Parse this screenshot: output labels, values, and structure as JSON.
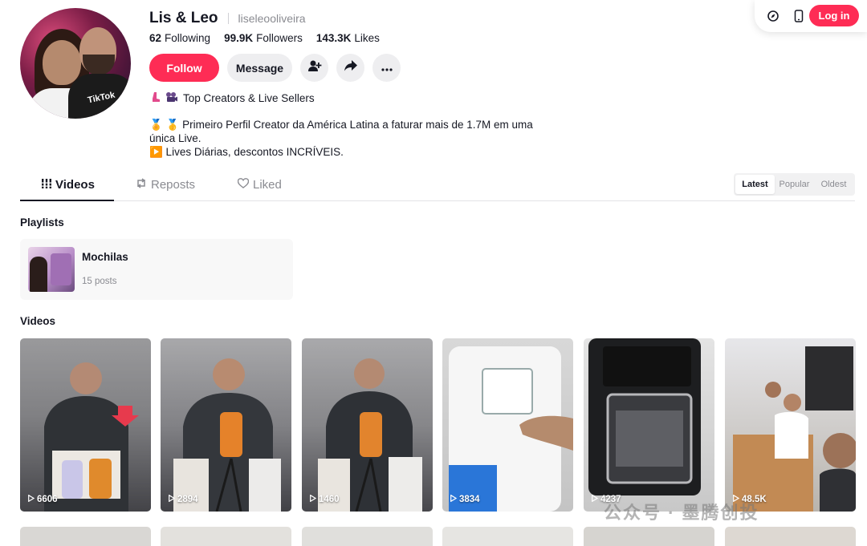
{
  "toolbar": {
    "icons": [
      "compass-icon",
      "phone-icon"
    ],
    "login_label": "Log in",
    "accent_color": "#fe2c55"
  },
  "profile": {
    "name": "Lis & Leo",
    "handle": "liseleooliveira",
    "following_count": "62",
    "following_label": "Following",
    "followers_count": "99.9K",
    "followers_label": "Followers",
    "likes_count": "143.3K",
    "likes_label": "Likes",
    "follow_label": "Follow",
    "message_label": "Message",
    "badge_text": "Top Creators & Live Sellers",
    "bio_lines": [
      "🏅 🥇 Primeiro Perfil Creator da América Latina a faturar mais de 1.7M em uma",
      "única Live.",
      "▶️ Lives Diárias, descontos INCRÍVEIS."
    ]
  },
  "tabs": [
    {
      "label": "Videos",
      "icon": "grid-icon",
      "active": true
    },
    {
      "label": "Reposts",
      "icon": "repost-icon",
      "active": false
    },
    {
      "label": "Liked",
      "icon": "liked-heart-icon",
      "active": false
    }
  ],
  "sort": {
    "options": [
      "Latest",
      "Popular",
      "Oldest"
    ],
    "selected": "Latest"
  },
  "playlists": {
    "heading": "Playlists",
    "items": [
      {
        "name": "Mochilas",
        "count": "15 posts"
      }
    ]
  },
  "videos": {
    "heading": "Videos",
    "items": [
      {
        "views": "6606"
      },
      {
        "views": "2894"
      },
      {
        "views": "1460"
      },
      {
        "views": "3834"
      },
      {
        "views": "4237"
      },
      {
        "views": "48.5K"
      }
    ]
  },
  "watermark": "公众号 · 墨腾创投"
}
